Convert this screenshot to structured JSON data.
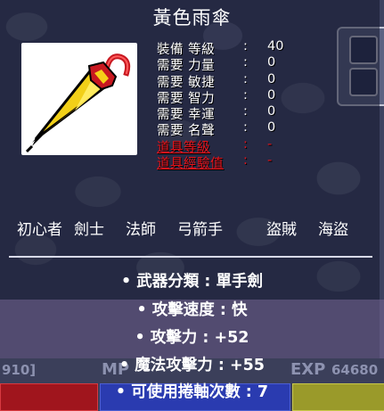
{
  "item": {
    "name": "黃色雨傘"
  },
  "stats": [
    {
      "label": "裝備 等級",
      "sep": ":",
      "value": "40",
      "style": "normal"
    },
    {
      "label": "需要 力量",
      "sep": ":",
      "value": "0",
      "style": "normal"
    },
    {
      "label": "需要 敏捷",
      "sep": ":",
      "value": "0",
      "style": "normal"
    },
    {
      "label": "需要 智力",
      "sep": ":",
      "value": "0",
      "style": "normal"
    },
    {
      "label": "需要 幸運",
      "sep": ":",
      "value": "0",
      "style": "normal"
    },
    {
      "label": "需要 名聲",
      "sep": ":",
      "value": "0",
      "style": "normal"
    },
    {
      "label": "道具等級",
      "sep": ":",
      "value": "-",
      "style": "red"
    },
    {
      "label": "道具經驗值",
      "sep": ":",
      "value": "-",
      "style": "red"
    }
  ],
  "jobs": [
    "初心者",
    "劍士",
    "法師",
    "弓箭手",
    "盜賊",
    "海盜"
  ],
  "attributes": [
    "• 武器分類 : 單手劍",
    "• 攻擊速度 : 快",
    "• 攻擊力 : +52",
    "• 魔法攻擊力 : +55",
    "• 可使用捲軸次數 : 7"
  ],
  "hud": {
    "left_value": "910]",
    "mp_label": "MP",
    "exp_label": "EXP",
    "exp_value": "64680"
  },
  "colors": {
    "stat_text": "#ffffff",
    "stat_locked": "#e8141c",
    "umbrella_yellow": "#f2d018",
    "umbrella_red": "#c81820"
  }
}
